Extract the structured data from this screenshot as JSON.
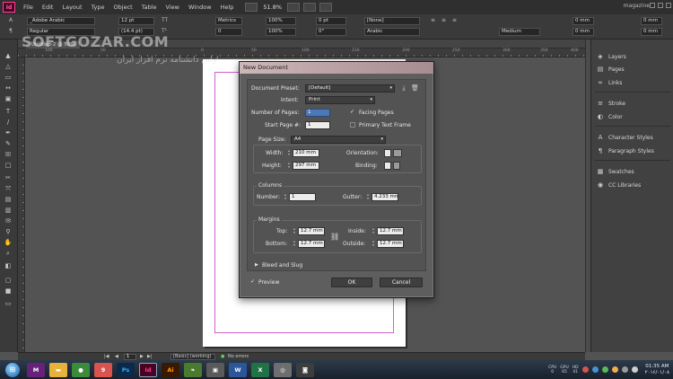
{
  "menu": {
    "logo": "Id",
    "items": [
      "File",
      "Edit",
      "Layout",
      "Type",
      "Object",
      "Table",
      "View",
      "Window",
      "Help"
    ],
    "zoom": "51.8%",
    "workspace": "magazine"
  },
  "control": {
    "font": "_Adobe Arabic",
    "style": "Regular",
    "size": "12 pt",
    "leading": "(14.4 pt)",
    "kerning": "Metrics",
    "tracking": "0",
    "scale_v": "100%",
    "scale_h": "100%",
    "baseline": "0 pt",
    "skew": "0°",
    "char_style": "[None]",
    "language": "Arabic",
    "digits": "Medium",
    "indent_l": "0 mm",
    "indent_r": "0 mm",
    "space_b": "0 mm",
    "space_a": "0 mm"
  },
  "document_tab": "Untitled-2 @ 52%",
  "ruler_numbers": [
    "100",
    "50",
    "0",
    "50",
    "100",
    "150",
    "200",
    "250",
    "300",
    "350",
    "400"
  ],
  "watermark": {
    "line1": "SOFTGOZAR.COM",
    "line2": "اولین دانشنامه نرم افزار ایران"
  },
  "dialog": {
    "title": "New Document",
    "preset_label": "Document Preset:",
    "preset_value": "[Default]",
    "intent_label": "Intent:",
    "intent_value": "Print",
    "pages_label": "Number of Pages:",
    "pages_value": "1",
    "start_label": "Start Page #:",
    "start_value": "1",
    "facing_pages": "Facing Pages",
    "primary_frame": "Primary Text Frame",
    "page_size_label": "Page Size:",
    "page_size_value": "A4",
    "width_label": "Width:",
    "width_value": "210 mm",
    "height_label": "Height:",
    "height_value": "297 mm",
    "orientation_label": "Orientation:",
    "binding_label": "Binding:",
    "columns_title": "Columns",
    "number_label": "Number:",
    "number_value": "1",
    "gutter_label": "Gutter:",
    "gutter_value": "4.233 mm",
    "margins_title": "Margins",
    "top_label": "Top:",
    "top_value": "12.7 mm",
    "bottom_label": "Bottom:",
    "bottom_value": "12.7 mm",
    "inside_label": "Inside:",
    "inside_value": "12.7 mm",
    "outside_label": "Outside:",
    "outside_value": "12.7 mm",
    "bleed_slug": "Bleed and Slug",
    "preview": "Preview",
    "ok": "OK",
    "cancel": "Cancel"
  },
  "panels": [
    {
      "label": "Layers",
      "icon": "layers-icon",
      "glyph": "◈"
    },
    {
      "label": "Pages",
      "icon": "pages-icon",
      "glyph": "▤"
    },
    {
      "label": "Links",
      "icon": "links-icon",
      "glyph": "∞"
    },
    {
      "label": "Stroke",
      "icon": "stroke-icon",
      "glyph": "≡"
    },
    {
      "label": "Color",
      "icon": "color-icon",
      "glyph": "◐"
    },
    {
      "label": "Character Styles",
      "icon": "character-styles-icon",
      "glyph": "A"
    },
    {
      "label": "Paragraph Styles",
      "icon": "paragraph-styles-icon",
      "glyph": "¶"
    },
    {
      "label": "Swatches",
      "icon": "swatches-icon",
      "glyph": "▦"
    },
    {
      "label": "CC Libraries",
      "icon": "cc-libraries-icon",
      "glyph": "◉"
    }
  ],
  "status": {
    "page": "1",
    "style": "[Basic] (working)",
    "errors": "No errors"
  },
  "taskbar": {
    "apps": [
      {
        "name": "visual-studio",
        "glyph": "M",
        "color": "#68217a"
      },
      {
        "name": "file-explorer",
        "glyph": "▬",
        "color": "#e6b23c"
      },
      {
        "name": "chrome",
        "glyph": "●",
        "color": "#3b8b3b"
      },
      {
        "name": "app-9",
        "glyph": "9",
        "color": "#d9534f"
      },
      {
        "name": "photoshop",
        "glyph": "Ps",
        "color": "#0b2a4a"
      },
      {
        "name": "indesign",
        "glyph": "Id",
        "color": "#49021f"
      },
      {
        "name": "illustrator",
        "glyph": "Ai",
        "color": "#3b1800"
      },
      {
        "name": "app-leaf",
        "glyph": "❧",
        "color": "#4a7a2e"
      },
      {
        "name": "app-media",
        "glyph": "▣",
        "color": "#5a5a5a"
      },
      {
        "name": "word",
        "glyph": "W",
        "color": "#2b579a"
      },
      {
        "name": "excel",
        "glyph": "X",
        "color": "#217346"
      },
      {
        "name": "app-capture",
        "glyph": "◎",
        "color": "#6e6e6e"
      },
      {
        "name": "app-cam",
        "glyph": "◙",
        "color": "#3d3d3d"
      }
    ],
    "cpu_label": "CPU",
    "cpu_value": "0",
    "gpu_label": "GPU",
    "gpu_value": "65",
    "hd_label": "HD",
    "hd_value": "41",
    "time": "01:35 AM",
    "date": "۲۰۱۶/۰۱/۰۸"
  }
}
